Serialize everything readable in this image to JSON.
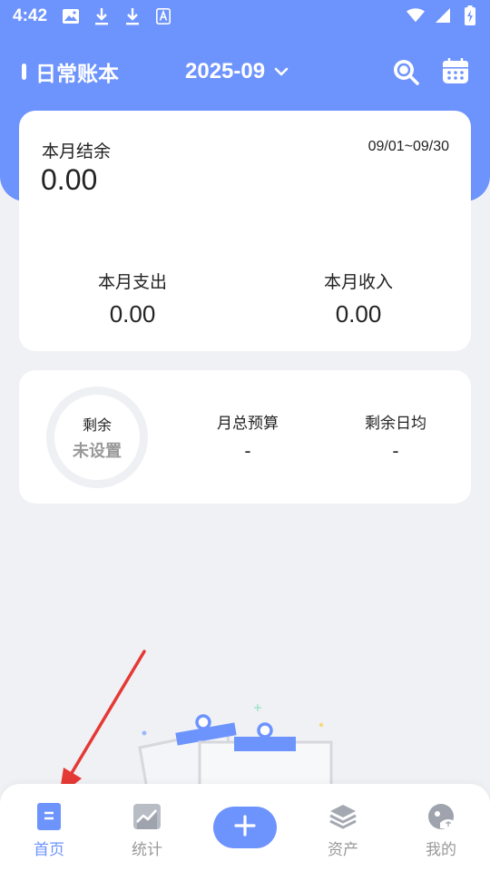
{
  "status_bar": {
    "time": "4:42",
    "left_icons": [
      "image-icon",
      "download-icon",
      "download-icon",
      "font-icon"
    ],
    "right_icons": [
      "wifi-icon",
      "signal-icon",
      "battery-charging-icon"
    ]
  },
  "header": {
    "book_title": "日常账本",
    "month": "2025-09",
    "bg_color": "#6d93fd"
  },
  "balance_card": {
    "label": "本月结余",
    "date_range": "09/01~09/30",
    "value": "0.00",
    "expense_label": "本月支出",
    "expense_value": "0.00",
    "income_label": "本月收入",
    "income_value": "0.00"
  },
  "budget_card": {
    "ring_label": "剩余",
    "ring_status": "未设置",
    "total_label": "月总预算",
    "total_value": "-",
    "daily_label": "剩余日均",
    "daily_value": "-"
  },
  "tabbar": {
    "tabs": [
      {
        "label": "首页",
        "icon": "home-doc-icon",
        "active": true
      },
      {
        "label": "统计",
        "icon": "chart-icon",
        "active": false
      },
      {
        "label": "资产",
        "icon": "layers-icon",
        "active": false
      },
      {
        "label": "我的",
        "icon": "profile-icon",
        "active": false
      }
    ],
    "add_icon": "plus-icon",
    "accent": "#6d93fd"
  }
}
